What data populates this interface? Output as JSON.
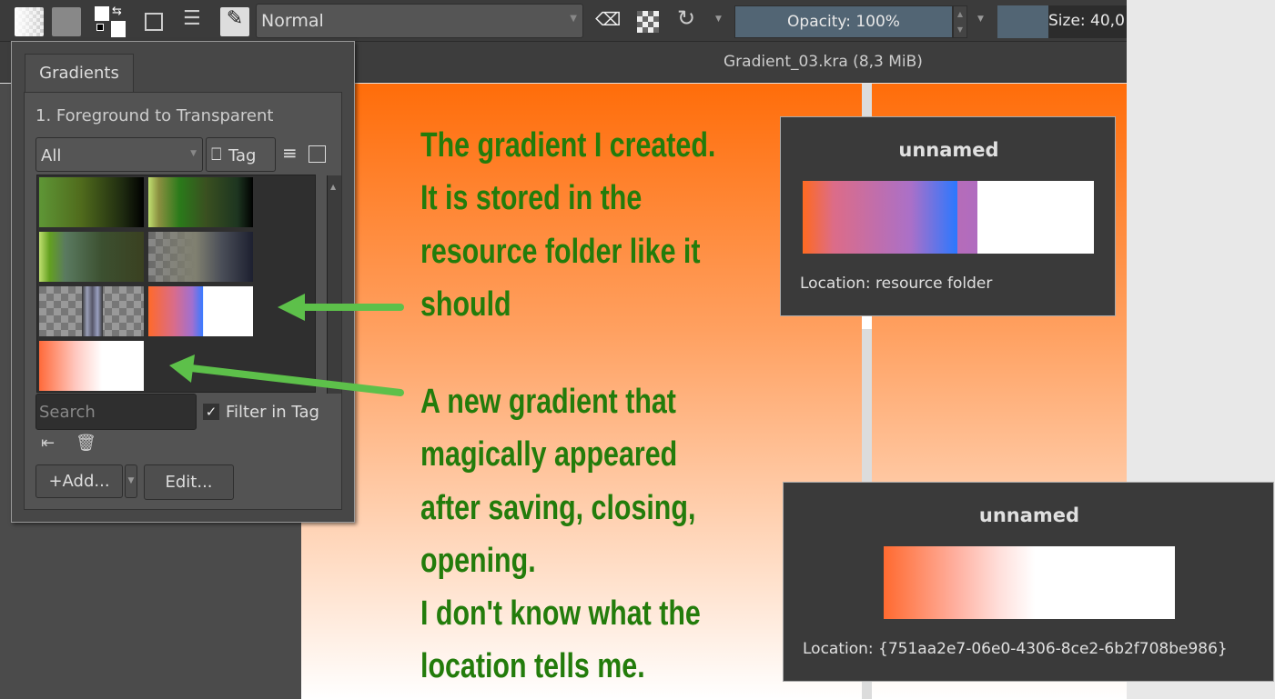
{
  "toolbar": {
    "blend_mode": "Normal",
    "opacity": "Opacity: 100%",
    "size": "Size: 40,0"
  },
  "document": {
    "title": "Gradient_03.kra (8,3 MiB)"
  },
  "panel": {
    "tab": "Gradients",
    "current": "1. Foreground to Transparent",
    "filter": "All",
    "tag": "Tag",
    "search_placeholder": "Search",
    "filter_in_tag": "Filter in Tag",
    "add": "Add...",
    "edit": "Edit..."
  },
  "annotations": {
    "top": [
      "The gradient I created.",
      "It is stored in the",
      "resource folder like it",
      "should"
    ],
    "bottom": [
      "A new gradient that",
      "magically appeared",
      "after saving, closing,",
      "opening.",
      "I don't know what the",
      "location tells me."
    ]
  },
  "tooltips": [
    {
      "name": "unnamed",
      "location_label": "Location:",
      "location": "resource folder"
    },
    {
      "name": "unnamed",
      "location_label": "Location:",
      "location": "{751aa2e7-06e0-4306-8ce2-6b2f708be986}"
    }
  ],
  "colors": {
    "annotation": "#237c0b",
    "arrow": "#5dc04a"
  }
}
